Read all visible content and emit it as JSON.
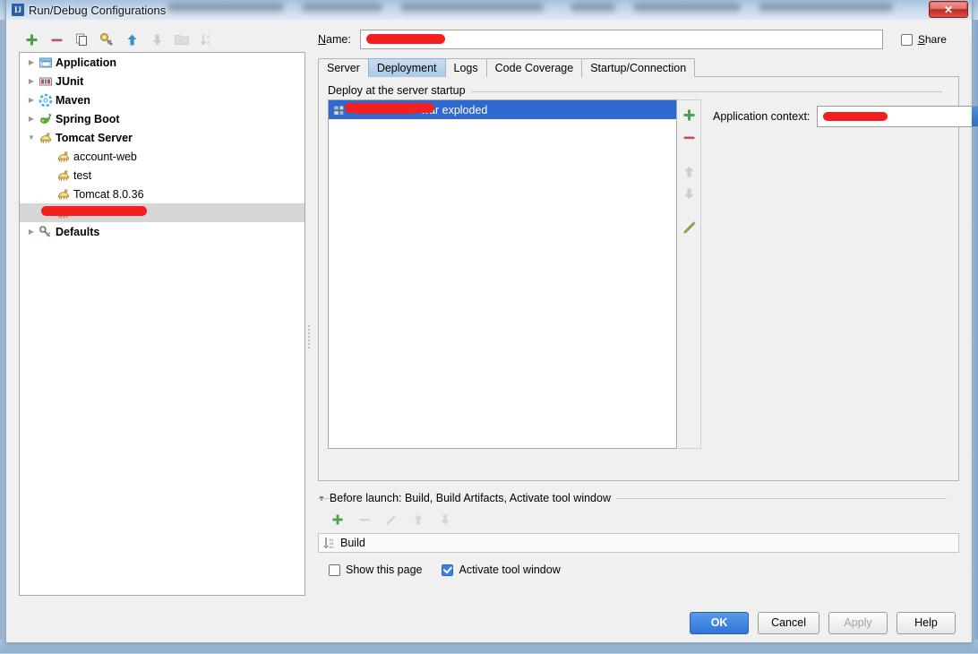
{
  "window": {
    "title": "Run/Debug Configurations",
    "app_icon": "intellij-idea-icon",
    "close_label": "✕"
  },
  "tree_toolbar": {
    "buttons": [
      {
        "name": "add-configuration-button",
        "icon": "plus-icon",
        "enabled": true
      },
      {
        "name": "remove-configuration-button",
        "icon": "minus-icon",
        "enabled": true
      },
      {
        "name": "copy-configuration-button",
        "icon": "copy-icon",
        "enabled": true
      },
      {
        "name": "edit-templates-button",
        "icon": "wrench-icon",
        "enabled": true
      },
      {
        "name": "move-up-button",
        "icon": "arrow-up-icon",
        "enabled": true
      },
      {
        "name": "move-down-button",
        "icon": "arrow-down-icon",
        "enabled": false
      },
      {
        "name": "create-folder-button",
        "icon": "folder-icon",
        "enabled": false
      },
      {
        "name": "sort-configurations-button",
        "icon": "sort-az-icon",
        "enabled": false
      }
    ]
  },
  "tree": {
    "items": [
      {
        "label": "Application",
        "icon": "application-icon",
        "expandable": true,
        "expanded": false,
        "bold": true,
        "child": false,
        "selected": false,
        "redacted": false
      },
      {
        "label": "JUnit",
        "icon": "junit-icon",
        "expandable": true,
        "expanded": false,
        "bold": true,
        "child": false,
        "selected": false,
        "redacted": false
      },
      {
        "label": "Maven",
        "icon": "maven-icon",
        "expandable": true,
        "expanded": false,
        "bold": true,
        "child": false,
        "selected": false,
        "redacted": false
      },
      {
        "label": "Spring Boot",
        "icon": "spring-boot-icon",
        "expandable": true,
        "expanded": false,
        "bold": true,
        "child": false,
        "selected": false,
        "redacted": false
      },
      {
        "label": "Tomcat Server",
        "icon": "tomcat-icon",
        "expandable": true,
        "expanded": true,
        "bold": true,
        "child": false,
        "selected": false,
        "redacted": false
      },
      {
        "label": "account-web",
        "icon": "tomcat-icon",
        "expandable": false,
        "expanded": false,
        "bold": false,
        "child": true,
        "selected": false,
        "redacted": false
      },
      {
        "label": "test",
        "icon": "tomcat-icon",
        "expandable": false,
        "expanded": false,
        "bold": false,
        "child": true,
        "selected": false,
        "redacted": false
      },
      {
        "label": "Tomcat 8.0.36",
        "icon": "tomcat-icon",
        "expandable": false,
        "expanded": false,
        "bold": false,
        "child": true,
        "selected": false,
        "redacted": false
      },
      {
        "label": "",
        "icon": "tomcat-icon",
        "expandable": false,
        "expanded": false,
        "bold": false,
        "child": true,
        "selected": true,
        "redacted": true
      },
      {
        "label": "Defaults",
        "icon": "defaults-icon",
        "expandable": true,
        "expanded": false,
        "bold": true,
        "child": false,
        "selected": false,
        "redacted": false
      }
    ]
  },
  "name_row": {
    "label": "Name:",
    "label_mnemonic": "N",
    "value": "",
    "value_redacted": true,
    "share_label": "Share",
    "share_mnemonic": "S",
    "share_checked": false
  },
  "tabs": [
    {
      "label": "Server",
      "active": false
    },
    {
      "label": "Deployment",
      "active": true
    },
    {
      "label": "Logs",
      "active": false
    },
    {
      "label": "Code Coverage",
      "active": false
    },
    {
      "label": "Startup/Connection",
      "active": false
    }
  ],
  "deployment": {
    "group_label": "Deploy at the server startup",
    "items": [
      {
        "label": "war exploded",
        "icon": "artifact-icon",
        "selected": true,
        "redacted": true
      }
    ],
    "side_buttons": [
      {
        "name": "add-artifact-button",
        "icon": "plus-icon",
        "enabled": true
      },
      {
        "name": "remove-artifact-button",
        "icon": "minus-icon",
        "enabled": true
      },
      {
        "name": "move-artifact-up-button",
        "icon": "arrow-up-icon",
        "enabled": false
      },
      {
        "name": "move-artifact-down-button",
        "icon": "arrow-down-icon",
        "enabled": false
      },
      {
        "name": "edit-artifact-button",
        "icon": "pencil-icon",
        "enabled": true
      }
    ],
    "application_context": {
      "label": "Application context:",
      "value": "",
      "value_redacted": true,
      "dropdown_icon": "chevron-down-icon"
    }
  },
  "before_launch": {
    "header": "Before launch: Build, Build Artifacts, Activate tool window",
    "header_mnemonic": "B",
    "toolbar": [
      {
        "name": "add-task-button",
        "icon": "plus-icon",
        "enabled": true
      },
      {
        "name": "remove-task-button",
        "icon": "minus-icon",
        "enabled": false
      },
      {
        "name": "edit-task-button",
        "icon": "pencil-icon",
        "enabled": false
      },
      {
        "name": "move-task-up-button",
        "icon": "arrow-up-icon",
        "enabled": false
      },
      {
        "name": "move-task-down-button",
        "icon": "arrow-down-icon",
        "enabled": false
      }
    ],
    "tasks": [
      {
        "label": "Build",
        "icon": "build-icon"
      }
    ],
    "show_this_page": {
      "label": "Show this page",
      "checked": false
    },
    "activate_tool_window": {
      "label": "Activate tool window",
      "checked": true
    }
  },
  "footer": {
    "ok": "OK",
    "cancel": "Cancel",
    "apply": "Apply",
    "apply_enabled": false,
    "help": "Help"
  },
  "colors": {
    "accent_blue": "#2f68d0",
    "tab_active": "#aac9e8",
    "redaction_red": "#f41f1f",
    "selection_gray": "#d6d6d6",
    "dialog_bg": "#f0f0f0"
  }
}
